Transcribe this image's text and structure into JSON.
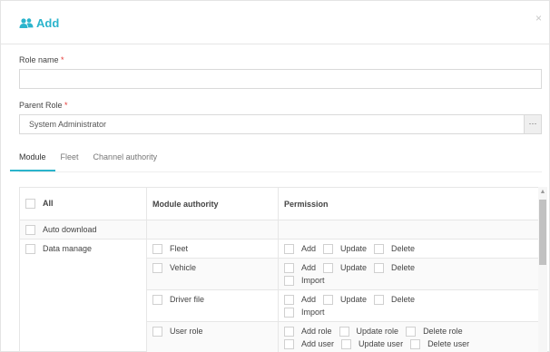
{
  "dialog": {
    "title": "Add",
    "close_icon": "close-icon"
  },
  "form": {
    "role_name": {
      "label": "Role name",
      "required_mark": "*",
      "value": ""
    },
    "parent_role": {
      "label": "Parent Role",
      "required_mark": "*",
      "value": "System Administrator",
      "button_label": "···"
    }
  },
  "tabs": [
    {
      "label": "Module",
      "active": true
    },
    {
      "label": "Fleet",
      "active": false
    },
    {
      "label": "Channel authority",
      "active": false
    }
  ],
  "table": {
    "headers": {
      "all": "All",
      "module_authority": "Module authority",
      "permission": "Permission"
    },
    "rows": {
      "auto_download": "Auto download",
      "data_manage": "Data manage",
      "fleet": {
        "label": "Fleet",
        "perms": [
          "Add",
          "Update",
          "Delete"
        ]
      },
      "vehicle": {
        "label": "Vehicle",
        "perms": [
          "Add",
          "Update",
          "Delete",
          "Import"
        ]
      },
      "driver_file": {
        "label": "Driver file",
        "perms": [
          "Add",
          "Update",
          "Delete",
          "Import"
        ]
      },
      "user_role": {
        "label": "User role",
        "perms": [
          "Add role",
          "Update role",
          "Delete role",
          "Add user",
          "Update user",
          "Delete user"
        ]
      }
    }
  },
  "colors": {
    "accent": "#2bb4cc",
    "required": "#e53935"
  },
  "scrollbar": {
    "up_icon": "▲"
  }
}
